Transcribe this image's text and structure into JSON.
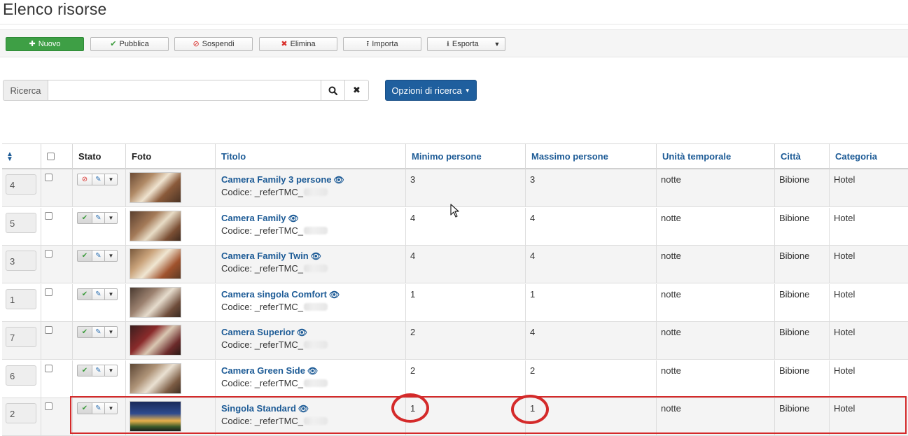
{
  "page": {
    "title": "Elenco risorse"
  },
  "toolbar": {
    "new_label": "Nuovo",
    "publish_label": "Pubblica",
    "suspend_label": "Sospendi",
    "delete_label": "Elimina",
    "import_label": "Importa",
    "export_label": "Esporta"
  },
  "search": {
    "label": "Ricerca",
    "value": "",
    "placeholder": "",
    "options_label": "Opzioni di ricerca"
  },
  "table": {
    "headers": {
      "stato": "Stato",
      "foto": "Foto",
      "titolo": "Titolo",
      "minimo": "Minimo persone",
      "massimo": "Massimo persone",
      "unita": "Unità temporale",
      "citta": "Città",
      "categoria": "Categoria"
    },
    "rows": [
      {
        "order": "4",
        "status": "suspended",
        "title": "Camera Family 3 persone",
        "code": "Codice: _referTMC_",
        "min": "3",
        "max": "3",
        "unit": "notte",
        "city": "Bibione",
        "category": "Hotel"
      },
      {
        "order": "5",
        "status": "published",
        "title": "Camera Family",
        "code": "Codice: _referTMC_",
        "min": "4",
        "max": "4",
        "unit": "notte",
        "city": "Bibione",
        "category": "Hotel"
      },
      {
        "order": "3",
        "status": "published",
        "title": "Camera Family Twin",
        "code": "Codice: _referTMC_",
        "min": "4",
        "max": "4",
        "unit": "notte",
        "city": "Bibione",
        "category": "Hotel"
      },
      {
        "order": "1",
        "status": "published",
        "title": "Camera singola Comfort",
        "code": "Codice: _referTMC_",
        "min": "1",
        "max": "1",
        "unit": "notte",
        "city": "Bibione",
        "category": "Hotel"
      },
      {
        "order": "7",
        "status": "published",
        "title": "Camera Superior",
        "code": "Codice: _referTMC_",
        "min": "2",
        "max": "4",
        "unit": "notte",
        "city": "Bibione",
        "category": "Hotel"
      },
      {
        "order": "6",
        "status": "published",
        "title": "Camera Green Side",
        "code": "Codice: _referTMC_",
        "min": "2",
        "max": "2",
        "unit": "notte",
        "city": "Bibione",
        "category": "Hotel"
      },
      {
        "order": "2",
        "status": "published",
        "title": "Singola Standard",
        "code": "Codice: _referTMC_",
        "min": "1",
        "max": "1",
        "unit": "notte",
        "city": "Bibione",
        "category": "Hotel"
      }
    ]
  },
  "colors": {
    "accent_blue": "#1d5b96",
    "button_blue": "#1f5f9e",
    "new_green": "#3e9f45",
    "annotation_red": "#d42a2a"
  }
}
